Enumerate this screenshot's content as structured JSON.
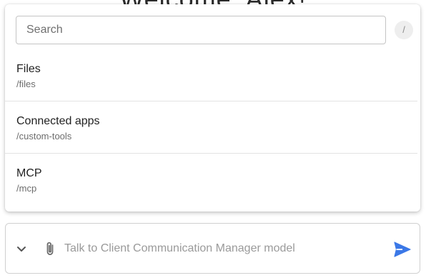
{
  "background_heading": "Welcome, Alex!",
  "search": {
    "placeholder": "Search",
    "shortcut": "/"
  },
  "commands": [
    {
      "title": "Files",
      "path": "/files"
    },
    {
      "title": "Connected apps",
      "path": "/custom-tools"
    },
    {
      "title": "MCP",
      "path": "/mcp"
    }
  ],
  "composer": {
    "placeholder": "Talk to Client Communication Manager model",
    "expand_icon": "chevron-down-icon",
    "attach_icon": "paperclip-icon",
    "send_icon": "send-icon"
  },
  "colors": {
    "accent": "#3b78e7"
  }
}
